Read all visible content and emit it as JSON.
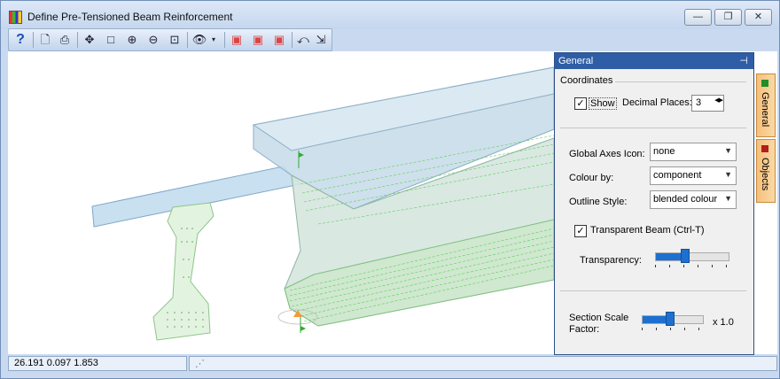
{
  "window": {
    "title": "Define Pre-Tensioned Beam Reinforcement"
  },
  "titlebar_buttons": {
    "minimize": "—",
    "restore": "❐",
    "close": "✕"
  },
  "toolbar_icons": [
    "help-icon",
    "print-preview-icon",
    "print-icon",
    "pan-icon",
    "select-box-icon",
    "zoom-in-icon",
    "zoom-out-icon",
    "zoom-extents-icon",
    "view-icon",
    "view-dropdown-icon",
    "cube-front-icon",
    "cube-side-icon",
    "cube-iso-icon",
    "reset-view-icon",
    "export-view-icon"
  ],
  "panel": {
    "title": "General",
    "coordinates": {
      "heading": "Coordinates",
      "show_label": "Show",
      "show_checked": true,
      "decimal_label": "Decimal Places:",
      "decimal_value": "3"
    },
    "global_axes": {
      "label": "Global Axes Icon:",
      "value": "none"
    },
    "colour_by": {
      "label": "Colour by:",
      "value": "component"
    },
    "outline_style": {
      "label": "Outline Style:",
      "value": "blended colour"
    },
    "transparent": {
      "label": "Transparent Beam (Ctrl-T)",
      "checked": true
    },
    "transparency": {
      "label": "Transparency:",
      "fraction": 0.4
    },
    "section_scale": {
      "label_line1": "Section Scale",
      "label_line2": "Factor:",
      "value_text": "x 1.0",
      "fraction": 0.45
    }
  },
  "side_tabs": [
    {
      "label": "General",
      "color": "#1f8f2a"
    },
    {
      "label": "Objects",
      "color": "#b51c1c"
    }
  ],
  "status": {
    "coords": "26.191  0.097  1.853"
  },
  "colors": {
    "panel_header": "#2f5ea6",
    "accent": "#1e70d0",
    "beam": "#b8d4e6",
    "strands": "#5ccf5c"
  }
}
